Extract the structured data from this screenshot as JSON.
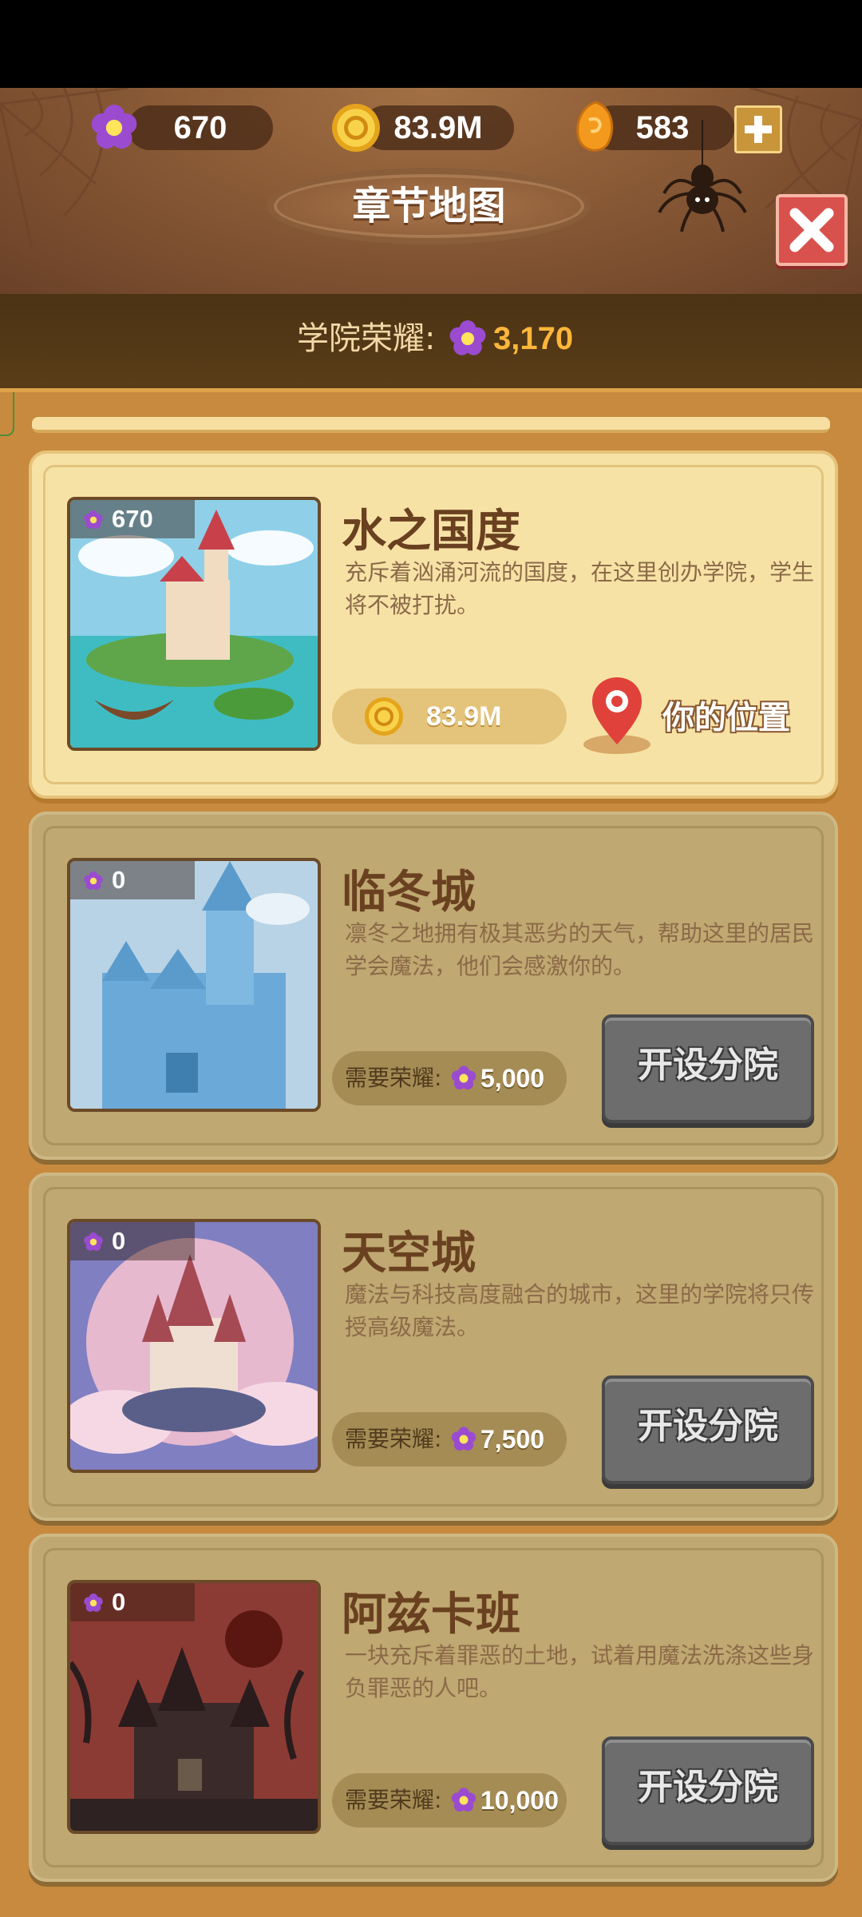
{
  "top_bar": {
    "gems": "670",
    "coins": "83.9M",
    "shards": "583"
  },
  "header": {
    "title": "章节地图"
  },
  "academy_honor": {
    "label": "学院荣耀:",
    "value": "3,170"
  },
  "chapters": [
    {
      "name": "水之国度",
      "description": "充斥着汹涌河流的国度，在这里创办学院，学生将不被打扰。",
      "honor": "670",
      "price": "83.9M",
      "location_label": "你的位置",
      "status": "current"
    },
    {
      "name": "临冬城",
      "description": "凛冬之地拥有极其恶劣的天气，帮助这里的居民学会魔法，他们会感激你的。",
      "honor": "0",
      "requirement_label": "需要荣耀:",
      "requirement_value": "5,000",
      "button_label": "开设分院",
      "status": "locked"
    },
    {
      "name": "天空城",
      "description": "魔法与科技高度融合的城市，这里的学院将只传授高级魔法。",
      "honor": "0",
      "requirement_label": "需要荣耀:",
      "requirement_value": "7,500",
      "button_label": "开设分院",
      "status": "locked"
    },
    {
      "name": "阿兹卡班",
      "description": "一块充斥着罪恶的土地，试着用魔法洗涤这些身负罪恶的人吧。",
      "honor": "0",
      "requirement_label": "需要荣耀:",
      "requirement_value": "10,000",
      "button_label": "开设分院",
      "status": "locked"
    }
  ],
  "colors": {
    "gem_purple": "#9b4bd0",
    "coin_gold": "#f3c12f",
    "shard_orange": "#f39a1e",
    "close_red": "#d9514c",
    "honor_orange": "#ffb63a"
  }
}
